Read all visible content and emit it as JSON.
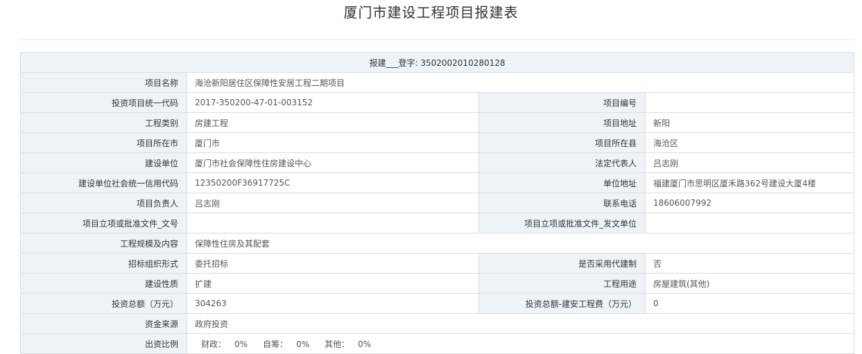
{
  "page": {
    "title": "厦门市建设工程项目报建表"
  },
  "header": {
    "registration": "报建___登字: 3502002010280128"
  },
  "rows": {
    "project_name": {
      "label": "项目名称",
      "value": "海沧新阳居住区保障性安居工程二期项目"
    },
    "investment_code": {
      "label": "投资项目统一代码",
      "value": "2017-350200-47-01-003152"
    },
    "project_number": {
      "label": "项目编号",
      "value": ""
    },
    "project_category": {
      "label": "工程类别",
      "value": "房建工程"
    },
    "project_address": {
      "label": "项目地址",
      "value": "新阳"
    },
    "project_city": {
      "label": "项目所在市",
      "value": "厦门市"
    },
    "project_county": {
      "label": "项目所在县",
      "value": "海沧区"
    },
    "construction_unit": {
      "label": "建设单位",
      "value": "厦门市社会保障性住房建设中心"
    },
    "legal_rep": {
      "label": "法定代表人",
      "value": "吕志刚"
    },
    "credit_code": {
      "label": "建设单位社会统一信用代码",
      "value": "12350200F36917725C"
    },
    "unit_address": {
      "label": "单位地址",
      "value": "福建厦门市思明区厦禾路362号建设大厦4楼"
    },
    "project_leader": {
      "label": "项目负责人",
      "value": "吕志刚"
    },
    "phone": {
      "label": "联系电话",
      "value": "18606007992"
    },
    "approval_doc_no": {
      "label": "项目立项或批准文件_文号",
      "value": ""
    },
    "approval_doc_issuer": {
      "label": "项目立项或批准文件_发文单位",
      "value": ""
    },
    "scale_content": {
      "label": "工程规模及内容",
      "value": "保障性住房及其配套"
    },
    "tender_form": {
      "label": "招标组织形式",
      "value": "委托招标"
    },
    "agent_construction": {
      "label": "是否采用代建制",
      "value": "否"
    },
    "construction_nature": {
      "label": "建设性质",
      "value": "扩建"
    },
    "project_use": {
      "label": "工程用途",
      "value": "房屋建筑(其他)"
    },
    "total_investment": {
      "label": "投资总额（万元）",
      "value": "304263"
    },
    "construction_cost": {
      "label": "投资总额-建安工程费（万元）",
      "value": "0"
    },
    "fund_source": {
      "label": "资金来源",
      "value": "政府投资"
    },
    "funding_ratio": {
      "label": "出资比例",
      "items": [
        {
          "label": "财政：",
          "value": "0%"
        },
        {
          "label": "自筹：",
          "value": "0%"
        },
        {
          "label": "其他：",
          "value": "0%"
        }
      ]
    }
  }
}
